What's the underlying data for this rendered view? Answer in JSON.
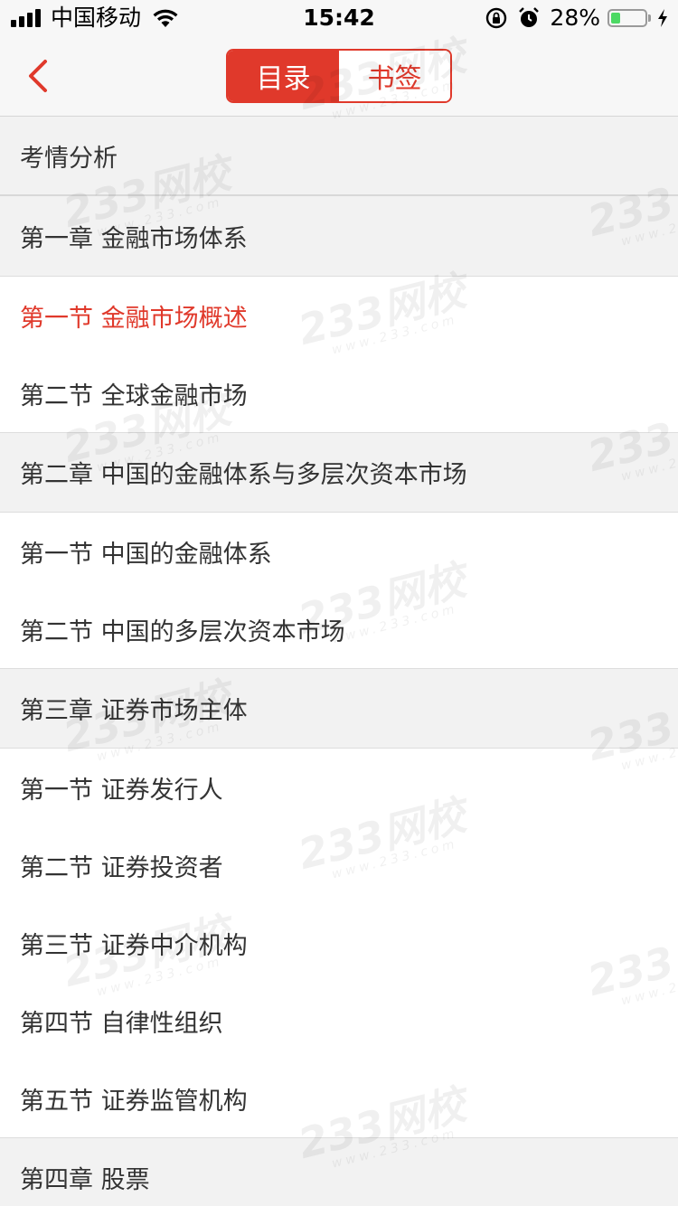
{
  "status_bar": {
    "carrier": "中国移动",
    "time": "15:42",
    "battery_percent": "28%",
    "battery_level": 0.28,
    "icons": [
      "signal-icon",
      "wifi-icon",
      "rotation-lock-icon",
      "alarm-icon",
      "battery-icon",
      "charging-bolt-icon"
    ]
  },
  "nav": {
    "back_icon": "back-arrow-icon",
    "tabs": [
      {
        "label": "目录",
        "active": true
      },
      {
        "label": "书签",
        "active": false
      }
    ]
  },
  "colors": {
    "accent": "#e0392b",
    "header_bg": "#f2f2f2",
    "text": "#333333"
  },
  "watermark": {
    "brand": "233网校",
    "url": "www.233.com"
  },
  "items": [
    {
      "text": "考情分析",
      "type": "header"
    },
    {
      "text": "第一章 金融市场体系",
      "type": "header"
    },
    {
      "text": "第一节 金融市场概述",
      "type": "sub",
      "active": true
    },
    {
      "text": "第二节 全球金融市场",
      "type": "sub"
    },
    {
      "text": "第二章 中国的金融体系与多层次资本市场",
      "type": "header"
    },
    {
      "text": "第一节 中国的金融体系",
      "type": "sub"
    },
    {
      "text": "第二节 中国的多层次资本市场",
      "type": "sub"
    },
    {
      "text": "第三章 证券市场主体",
      "type": "header"
    },
    {
      "text": "第一节 证券发行人",
      "type": "sub"
    },
    {
      "text": "第二节 证券投资者",
      "type": "sub"
    },
    {
      "text": "第三节 证券中介机构",
      "type": "sub"
    },
    {
      "text": "第四节 自律性组织",
      "type": "sub"
    },
    {
      "text": "第五节 证券监管机构",
      "type": "sub"
    },
    {
      "text": "第四章 股票",
      "type": "header"
    }
  ]
}
